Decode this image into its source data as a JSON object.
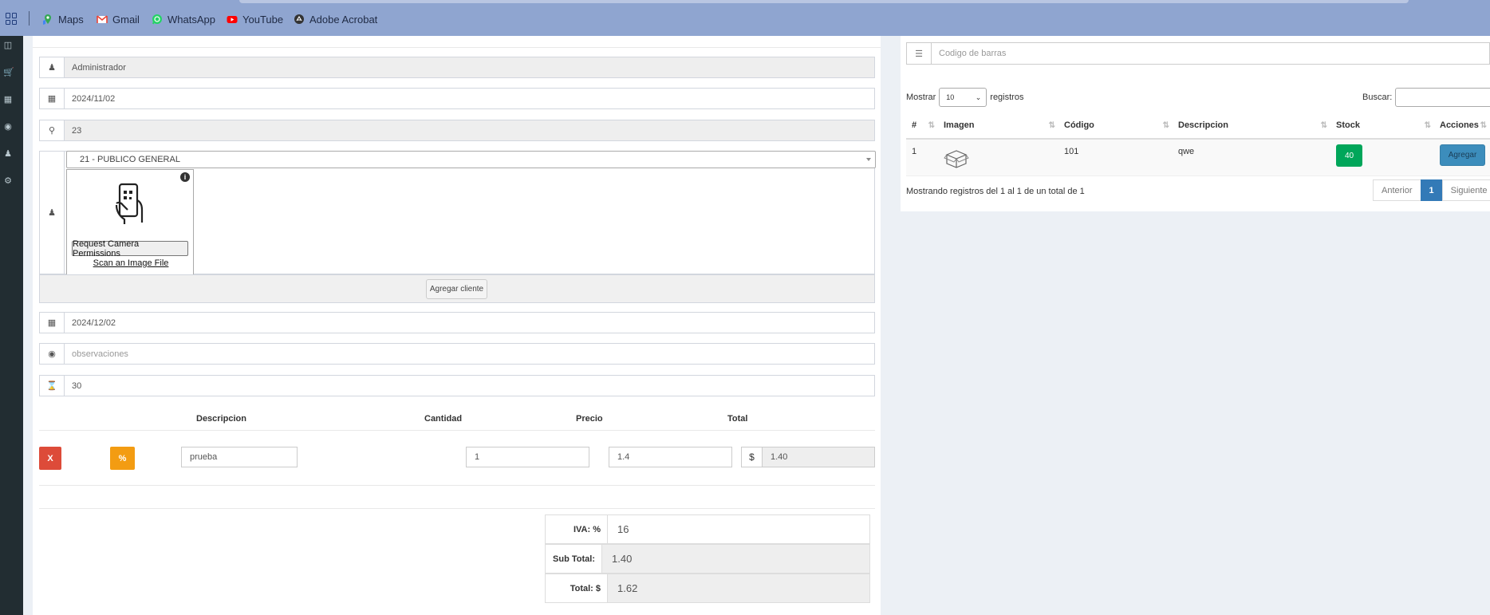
{
  "bookmarks": [
    {
      "label": "Maps",
      "icon": "maps-icon"
    },
    {
      "label": "Gmail",
      "icon": "gmail-icon"
    },
    {
      "label": "WhatsApp",
      "icon": "whatsapp-icon"
    },
    {
      "label": "YouTube",
      "icon": "youtube-icon"
    },
    {
      "label": "Adobe Acrobat",
      "icon": "acrobat-icon"
    }
  ],
  "form": {
    "seller": "Administrador",
    "date": "2024/11/02",
    "code": "23",
    "client": "21 - PUBLICO GENERAL",
    "scanner": {
      "permission_button": "Request Camera Permissions",
      "scan_file_link": "Scan an Image File"
    },
    "add_client_button": "Agregar cliente",
    "due_date": "2024/12/02",
    "observations_placeholder": "observaciones",
    "days": "30",
    "product_table": {
      "headers": {
        "descripcion": "Descripcion",
        "cantidad": "Cantidad",
        "precio": "Precio",
        "total": "Total"
      },
      "row": {
        "remove_label": "X",
        "discount_label": "%",
        "descripcion": "prueba",
        "cantidad": "1",
        "precio": "1.4",
        "currency": "$",
        "total": "1.40"
      }
    },
    "totals": {
      "iva_label": "IVA: %",
      "iva_value": "16",
      "subtotal_label": "Sub Total:",
      "subtotal_value": "1.40",
      "total_label": "Total: $",
      "total_value": "1.62"
    }
  },
  "product_search": {
    "barcode_placeholder": "Codigo de barras",
    "show_label": "Mostrar",
    "page_length": "10",
    "records_label": "registros",
    "search_label": "Buscar:",
    "columns": [
      "#",
      "Imagen",
      "Código",
      "Descripcion",
      "Stock",
      "Acciones"
    ],
    "rows": [
      {
        "num": "1",
        "codigo": "101",
        "descripcion": "qwe",
        "stock": "40",
        "action": "Agregar"
      }
    ],
    "info": "Mostrando registros del 1 al 1 de un total de 1",
    "pagination": {
      "prev": "Anterior",
      "current": "1",
      "next": "Siguiente"
    }
  },
  "colors": {
    "bookmarks_bg": "#8fa5d0",
    "sidebar_bg": "#222d32",
    "danger": "#dd4b39",
    "warning": "#f39c12",
    "success": "#00a65a",
    "primary": "#3c8dbc"
  }
}
